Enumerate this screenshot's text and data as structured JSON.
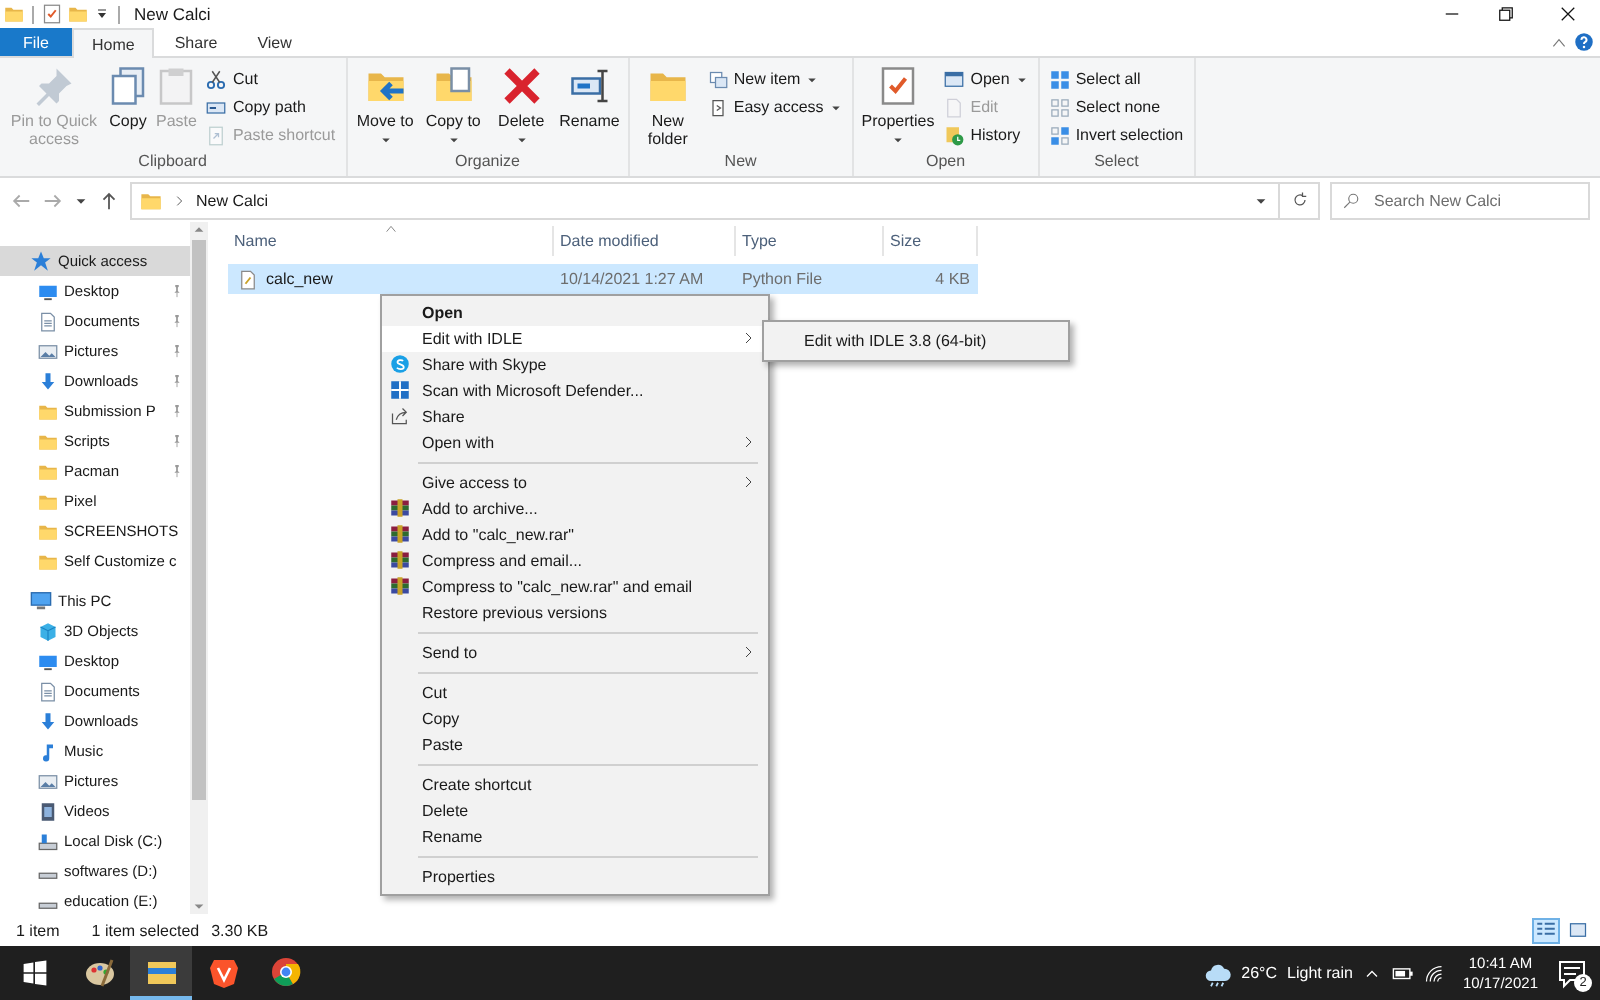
{
  "window": {
    "title": "New Calci"
  },
  "ribbon": {
    "tabs": [
      {
        "label": "File",
        "kind": "file",
        "selected": false
      },
      {
        "label": "Home",
        "kind": "tab",
        "selected": true
      },
      {
        "label": "Share",
        "kind": "tab",
        "selected": false
      },
      {
        "label": "View",
        "kind": "tab",
        "selected": false
      }
    ],
    "groups": [
      {
        "label": "Clipboard",
        "buttons": [
          {
            "label": "Pin to Quick access",
            "kind": "large",
            "disabled": true,
            "dropdown": false
          },
          {
            "label": "Copy",
            "kind": "large",
            "disabled": false,
            "dropdown": false
          },
          {
            "label": "Paste",
            "kind": "large",
            "disabled": true,
            "dropdown": false
          },
          {
            "label": "Cut",
            "kind": "small",
            "disabled": false,
            "dropdown": false
          },
          {
            "label": "Copy path",
            "kind": "small",
            "disabled": false,
            "dropdown": false
          },
          {
            "label": "Paste shortcut",
            "kind": "small",
            "disabled": true,
            "dropdown": false
          }
        ]
      },
      {
        "label": "Organize",
        "buttons": [
          {
            "label": "Move to",
            "kind": "large",
            "disabled": false,
            "dropdown": true
          },
          {
            "label": "Copy to",
            "kind": "large",
            "disabled": false,
            "dropdown": true
          },
          {
            "label": "Delete",
            "kind": "large",
            "disabled": false,
            "dropdown": true
          },
          {
            "label": "Rename",
            "kind": "large",
            "disabled": false,
            "dropdown": false
          }
        ]
      },
      {
        "label": "New",
        "buttons": [
          {
            "label": "New folder",
            "kind": "large",
            "disabled": false,
            "dropdown": false
          },
          {
            "label": "New item",
            "kind": "small",
            "disabled": false,
            "dropdown": true
          },
          {
            "label": "Easy access",
            "kind": "small",
            "disabled": false,
            "dropdown": true
          }
        ]
      },
      {
        "label": "Open",
        "buttons": [
          {
            "label": "Properties",
            "kind": "large",
            "disabled": false,
            "dropdown": true
          },
          {
            "label": "Open",
            "kind": "small",
            "disabled": false,
            "dropdown": true
          },
          {
            "label": "Edit",
            "kind": "small",
            "disabled": true,
            "dropdown": false
          },
          {
            "label": "History",
            "kind": "small",
            "disabled": false,
            "dropdown": false
          }
        ]
      },
      {
        "label": "Select",
        "buttons": [
          {
            "label": "Select all",
            "kind": "small",
            "disabled": false,
            "dropdown": false
          },
          {
            "label": "Select none",
            "kind": "small",
            "disabled": false,
            "dropdown": false
          },
          {
            "label": "Invert selection",
            "kind": "small",
            "disabled": false,
            "dropdown": false
          }
        ]
      }
    ]
  },
  "address_bar": {
    "path": [
      "New Calci"
    ],
    "search": {
      "placeholder": "Search New Calci"
    }
  },
  "navigation_pane": {
    "sections": [
      {
        "label": "Quick access",
        "selected": true,
        "children": [
          {
            "label": "Desktop",
            "pinned": true,
            "selected": false
          },
          {
            "label": "Documents",
            "pinned": true,
            "selected": false
          },
          {
            "label": "Pictures",
            "pinned": true,
            "selected": false
          },
          {
            "label": "Downloads",
            "pinned": true,
            "selected": false
          },
          {
            "label": "Submission P",
            "pinned": true,
            "selected": false
          },
          {
            "label": "Scripts",
            "pinned": true,
            "selected": false
          },
          {
            "label": "Pacman",
            "pinned": true,
            "selected": false
          },
          {
            "label": "Pixel",
            "pinned": false,
            "selected": false
          },
          {
            "label": "SCREENSHOTS",
            "pinned": false,
            "selected": false
          },
          {
            "label": "Self Customize c",
            "pinned": false,
            "selected": false
          }
        ]
      },
      {
        "label": "This PC",
        "selected": false,
        "children": [
          {
            "label": "3D Objects",
            "pinned": false,
            "selected": false
          },
          {
            "label": "Desktop",
            "pinned": false,
            "selected": false
          },
          {
            "label": "Documents",
            "pinned": false,
            "selected": false
          },
          {
            "label": "Downloads",
            "pinned": false,
            "selected": false
          },
          {
            "label": "Music",
            "pinned": false,
            "selected": false
          },
          {
            "label": "Pictures",
            "pinned": false,
            "selected": false
          },
          {
            "label": "Videos",
            "pinned": false,
            "selected": false
          },
          {
            "label": "Local Disk (C:)",
            "pinned": false,
            "selected": false
          },
          {
            "label": "softwares (D:)",
            "pinned": false,
            "selected": false
          },
          {
            "label": "education (E:)",
            "pinned": false,
            "selected": false
          }
        ]
      }
    ]
  },
  "file_list": {
    "columns": [
      "Name",
      "Date modified",
      "Type",
      "Size"
    ],
    "rows": [
      {
        "name": "calc_new",
        "date_modified": "10/14/2021 1:27 AM",
        "type": "Python File",
        "size": "4 KB",
        "selected": true
      }
    ]
  },
  "context_menu": {
    "items": [
      {
        "kind": "item",
        "label": "Open",
        "bold": true,
        "submenu": false,
        "highlighted": false
      },
      {
        "kind": "item",
        "label": "Edit with IDLE",
        "bold": false,
        "submenu": true,
        "highlighted": true,
        "submenu_items": [
          "Edit with IDLE 3.8 (64-bit)"
        ]
      },
      {
        "kind": "item",
        "label": "Share with Skype",
        "bold": false,
        "submenu": false,
        "highlighted": false
      },
      {
        "kind": "item",
        "label": "Scan with Microsoft Defender...",
        "bold": false,
        "submenu": false,
        "highlighted": false
      },
      {
        "kind": "item",
        "label": "Share",
        "bold": false,
        "submenu": false,
        "highlighted": false
      },
      {
        "kind": "item",
        "label": "Open with",
        "bold": false,
        "submenu": true,
        "highlighted": false
      },
      {
        "kind": "separator"
      },
      {
        "kind": "item",
        "label": "Give access to",
        "bold": false,
        "submenu": true,
        "highlighted": false
      },
      {
        "kind": "item",
        "label": "Add to archive...",
        "bold": false,
        "submenu": false,
        "highlighted": false
      },
      {
        "kind": "item",
        "label": "Add to \"calc_new.rar\"",
        "bold": false,
        "submenu": false,
        "highlighted": false
      },
      {
        "kind": "item",
        "label": "Compress and email...",
        "bold": false,
        "submenu": false,
        "highlighted": false
      },
      {
        "kind": "item",
        "label": "Compress to \"calc_new.rar\" and email",
        "bold": false,
        "submenu": false,
        "highlighted": false
      },
      {
        "kind": "item",
        "label": "Restore previous versions",
        "bold": false,
        "submenu": false,
        "highlighted": false
      },
      {
        "kind": "separator"
      },
      {
        "kind": "item",
        "label": "Send to",
        "bold": false,
        "submenu": true,
        "highlighted": false
      },
      {
        "kind": "separator"
      },
      {
        "kind": "item",
        "label": "Cut",
        "bold": false,
        "submenu": false,
        "highlighted": false
      },
      {
        "kind": "item",
        "label": "Copy",
        "bold": false,
        "submenu": false,
        "highlighted": false
      },
      {
        "kind": "item",
        "label": "Paste",
        "bold": false,
        "submenu": false,
        "highlighted": false
      },
      {
        "kind": "separator"
      },
      {
        "kind": "item",
        "label": "Create shortcut",
        "bold": false,
        "submenu": false,
        "highlighted": false
      },
      {
        "kind": "item",
        "label": "Delete",
        "bold": false,
        "submenu": false,
        "highlighted": false
      },
      {
        "kind": "item",
        "label": "Rename",
        "bold": false,
        "submenu": false,
        "highlighted": false
      },
      {
        "kind": "separator"
      },
      {
        "kind": "item",
        "label": "Properties",
        "bold": false,
        "submenu": false,
        "highlighted": false
      }
    ]
  },
  "status_bar": {
    "item_count": "1 item",
    "selection": "1 item selected",
    "selection_size": "3.30 KB",
    "views": [
      {
        "selected": true
      },
      {
        "selected": false
      }
    ]
  },
  "taskbar": {
    "apps": [
      {
        "active": false
      },
      {
        "active": true
      },
      {
        "active": false
      },
      {
        "active": false
      }
    ],
    "weather": {
      "temperature": "26°C",
      "condition": "Light rain"
    },
    "clock": {
      "time": "10:41 AM",
      "date": "10/17/2021"
    },
    "notification_count": "2"
  }
}
